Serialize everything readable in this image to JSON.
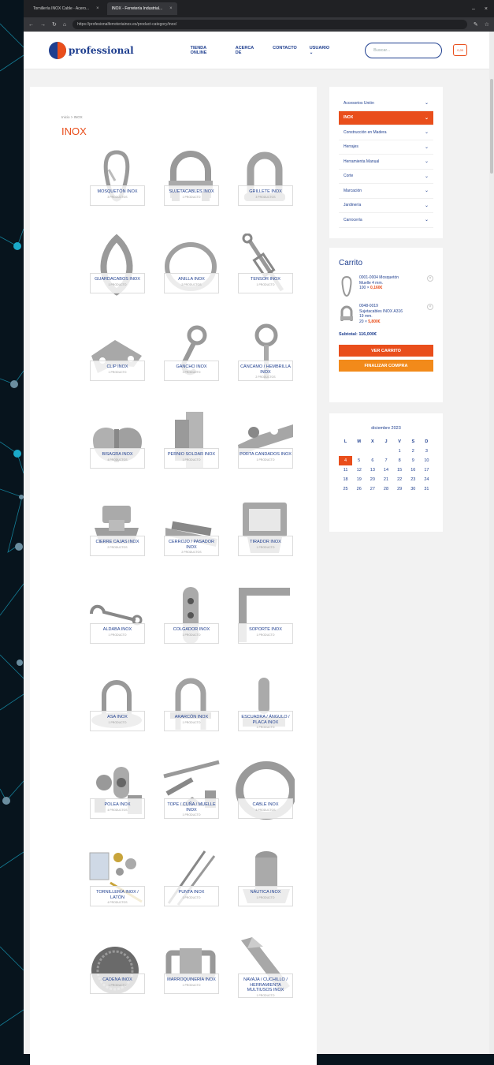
{
  "browser": {
    "tabs": [
      {
        "label": "Tornillería INOX Cable · Acero..."
      },
      {
        "label": "INOX - Ferretería Industrial..."
      }
    ],
    "url": "https://profesionalferreteriainox.es/product-category/inox/"
  },
  "header": {
    "logo_text": "professional",
    "menu": [
      "TIENDA ONLINE",
      "ACERCA DE",
      "CONTACTO",
      "USUARIO ⌄"
    ],
    "search_placeholder": "Buscar...",
    "cart_badge": "0,00"
  },
  "main": {
    "breadcrumb": "Inicio > INOX",
    "title": "INOX"
  },
  "categories": [
    {
      "name": "MOSQUETÓN INOX",
      "count": "3 PRODUCTOS",
      "icon": "carabiner"
    },
    {
      "name": "SUJETACABLES INOX",
      "count": "1 PRODUCTO",
      "icon": "clamp"
    },
    {
      "name": "GRILLETE INOX",
      "count": "3 PRODUCTOS",
      "icon": "shackle"
    },
    {
      "name": "GUARDACABOS INOX",
      "count": "1 PRODUCTO",
      "icon": "thimble"
    },
    {
      "name": "ANILLA INOX",
      "count": "2 PRODUCTOS",
      "icon": "ring"
    },
    {
      "name": "TENSOR INOX",
      "count": "1 PRODUCTO",
      "icon": "turnbuckle"
    },
    {
      "name": "CLIP INOX",
      "count": "1 PRODUCTO",
      "icon": "clip"
    },
    {
      "name": "GANCHO INOX",
      "count": "1 PRODUCTO",
      "icon": "hook"
    },
    {
      "name": "CÁNCAMO / HEMBRILLA INOX",
      "count": "2 PRODUCTOS",
      "icon": "eyebolt"
    },
    {
      "name": "BISAGRA INOX",
      "count": "4 PRODUCTOS",
      "icon": "hinge"
    },
    {
      "name": "PERNIO SOLDAR INOX",
      "count": "1 PRODUCTO",
      "icon": "pernio"
    },
    {
      "name": "PORTA CANDADOS INOX",
      "count": "1 PRODUCTO",
      "icon": "hasp"
    },
    {
      "name": "CIERRE CAJAS INOX",
      "count": "2 PRODUCTOS",
      "icon": "latch"
    },
    {
      "name": "CERROJO / PASADOR INOX",
      "count": "2 PRODUCTOS",
      "icon": "bolt"
    },
    {
      "name": "TIRADOR INOX",
      "count": "1 PRODUCTO",
      "icon": "handle"
    },
    {
      "name": "ALDABA INOX",
      "count": "1 PRODUCTO",
      "icon": "hookeye"
    },
    {
      "name": "COLGADOR INOX",
      "count": "1 PRODUCTO",
      "icon": "hanger"
    },
    {
      "name": "SOPORTE INOX",
      "count": "1 PRODUCTO",
      "icon": "bracket"
    },
    {
      "name": "ASA INOX",
      "count": "1 PRODUCTO",
      "icon": "padeye"
    },
    {
      "name": "ARARCÓN INOX",
      "count": "1 PRODUCTO",
      "icon": "ubolt"
    },
    {
      "name": "ESCUADRA / ÁNGULO / PLACA INOX",
      "count": "1 PRODUCTO",
      "icon": "plate"
    },
    {
      "name": "POLEA INOX",
      "count": "4 PRODUCTOS",
      "icon": "pulley"
    },
    {
      "name": "TOPE / CUÑA / MUELLE INOX",
      "count": "1 PRODUCTO",
      "icon": "tools"
    },
    {
      "name": "CABLE INOX",
      "count": "4 PRODUCTOS",
      "icon": "cable"
    },
    {
      "name": "TORNILLERÍA INOX / LATÓN",
      "count": "4 PRODUCTOS",
      "icon": "screws"
    },
    {
      "name": "PUNTA INOX",
      "count": "1 PRODUCTO",
      "icon": "nails"
    },
    {
      "name": "NÁUTICA INOX",
      "count": "1 PRODUCTO",
      "icon": "nautical"
    },
    {
      "name": "CADENA INOX",
      "count": "1 PRODUCTO",
      "icon": "chain"
    },
    {
      "name": "MARROQUINERÍA INOX",
      "count": "1 PRODUCTO",
      "icon": "buckle"
    },
    {
      "name": "NAVAJA / CUCHILLO / HERRAMIENTA MULTIUSOS INOX",
      "count": "1 PRODUCTO",
      "icon": "knife"
    }
  ],
  "sidebar": {
    "items": [
      {
        "label": "Accesorios Unión",
        "active": false
      },
      {
        "label": "INOX",
        "active": true
      },
      {
        "label": "Construcción en Madera",
        "active": false
      },
      {
        "label": "Herrajes",
        "active": false
      },
      {
        "label": "Herramienta Manual",
        "active": false
      },
      {
        "label": "Corte",
        "active": false
      },
      {
        "label": "Marcación",
        "active": false
      },
      {
        "label": "Jardinería",
        "active": false
      },
      {
        "label": "Carrocería",
        "active": false
      }
    ]
  },
  "cart": {
    "title": "Carrito",
    "items": [
      {
        "line1": "0001-0004 Mosquetón",
        "line2": "Muelle 4 mm.",
        "qty": "100 ×",
        "price": "0,160€"
      },
      {
        "line1": "0048-0019",
        "line2": "Sujetacables INOX A316",
        "line3": "19 mm.",
        "qty": "20 ×",
        "price": "5,800€"
      }
    ],
    "subtotal": "Subtotal: 116,000€",
    "view_label": "VER CARRITO",
    "checkout_label": "FINALIZAR COMPRA"
  },
  "calendar": {
    "title": "diciembre 2023",
    "days": [
      "L",
      "M",
      "X",
      "J",
      "V",
      "S",
      "D"
    ],
    "weeks": [
      [
        "",
        "",
        "",
        "",
        "1",
        "2",
        "3"
      ],
      [
        "4",
        "5",
        "6",
        "7",
        "8",
        "9",
        "10"
      ],
      [
        "11",
        "12",
        "13",
        "14",
        "15",
        "16",
        "17"
      ],
      [
        "18",
        "19",
        "20",
        "21",
        "22",
        "23",
        "24"
      ],
      [
        "25",
        "26",
        "27",
        "28",
        "29",
        "30",
        "31"
      ]
    ],
    "today": "4"
  },
  "colors": {
    "brand_blue": "#1f3f8f",
    "brand_orange": "#e94e1b",
    "accent_orange": "#f28a1a"
  }
}
